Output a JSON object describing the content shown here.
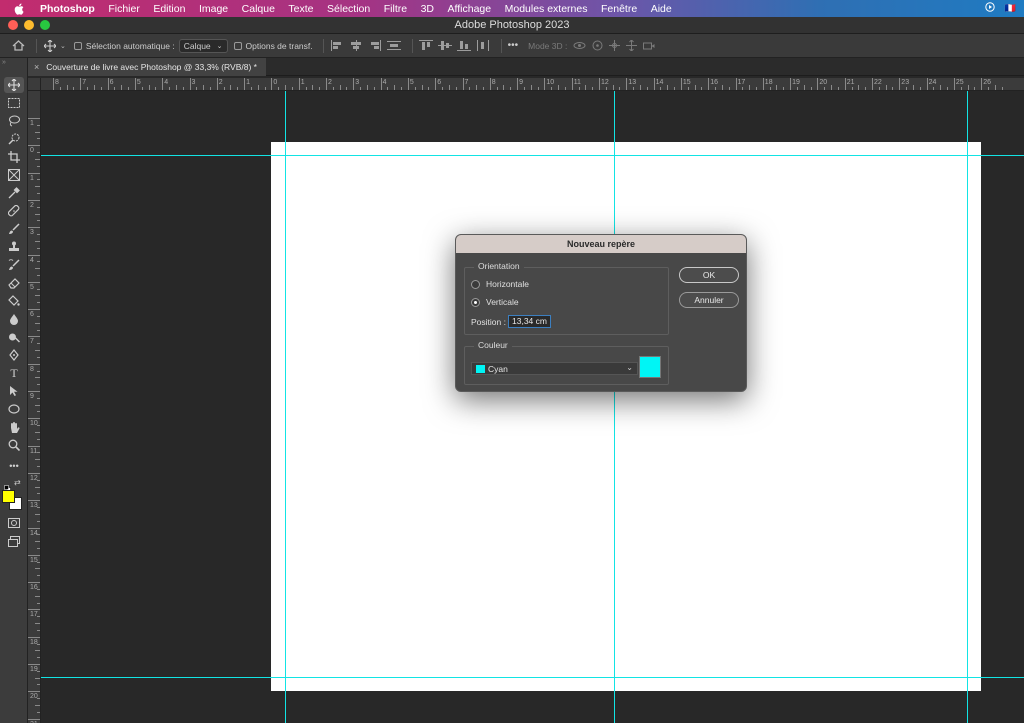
{
  "menubar": {
    "app_name": "Photoshop",
    "items": [
      "Fichier",
      "Edition",
      "Image",
      "Calque",
      "Texte",
      "Sélection",
      "Filtre",
      "3D",
      "Affichage",
      "Modules externes",
      "Fenêtre",
      "Aide"
    ],
    "flag": "🇫🇷"
  },
  "window": {
    "title": "Adobe Photoshop 2023"
  },
  "options_bar": {
    "auto_select_label": "Sélection automatique :",
    "auto_select_value": "Calque",
    "transform_label": "Options de transf.",
    "more": "•••",
    "mode3d_label": "Mode 3D :"
  },
  "document": {
    "tab_title": "Couverture de livre avec Photoshop @ 33,3% (RVB/8) *",
    "close_glyph": "×"
  },
  "rulers": {
    "h_labels": [
      "8",
      "7",
      "6",
      "5",
      "4",
      "3",
      "2",
      "1",
      "0",
      "1",
      "2",
      "3",
      "4",
      "5",
      "6",
      "7",
      "8",
      "9",
      "10",
      "11",
      "12",
      "13",
      "14",
      "15",
      "16",
      "17",
      "18",
      "19",
      "20",
      "21",
      "22",
      "23",
      "24",
      "25",
      "26"
    ],
    "v_labels": [
      "1",
      "0",
      "1",
      "2",
      "3",
      "4",
      "5",
      "6",
      "7",
      "8",
      "9",
      "10",
      "11",
      "12",
      "13",
      "14",
      "15",
      "16",
      "17",
      "18",
      "19",
      "20",
      "21"
    ]
  },
  "dialog": {
    "title": "Nouveau repère",
    "orientation_label": "Orientation",
    "horizontal_label": "Horizontale",
    "vertical_label": "Verticale",
    "selected_orientation": "Verticale",
    "position_label": "Position :",
    "position_value": "13,34 cm",
    "color_label": "Couleur",
    "color_value": "Cyan",
    "color_hex": "#00f5f5",
    "ok_label": "OK",
    "cancel_label": "Annuler"
  },
  "colors": {
    "foreground": "#ffff00",
    "background": "#ffffff",
    "guide": "#12e4e4"
  },
  "tools": [
    "move-icon",
    "marquee-icon",
    "lasso-icon",
    "quick-select-icon",
    "crop-icon",
    "frame-icon",
    "eyedropper-icon",
    "healing-icon",
    "brush-icon",
    "stamp-icon",
    "history-brush-icon",
    "eraser-icon",
    "bucket-icon",
    "blur-icon",
    "dodge-icon",
    "pen-icon",
    "type-icon",
    "path-select-icon",
    "shape-icon",
    "hand-icon",
    "zoom-icon",
    "more-tools-icon"
  ]
}
